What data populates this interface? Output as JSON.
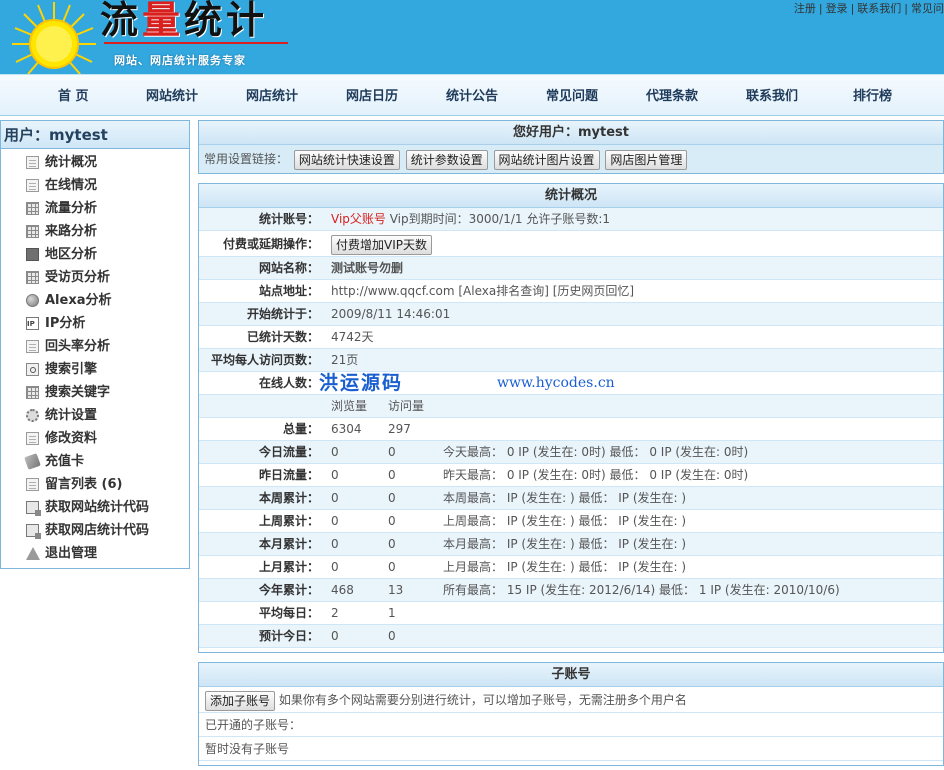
{
  "header": {
    "logo_title_1": "流",
    "logo_title_2": "量",
    "logo_title_3": "统计",
    "logo_subtitle": "网站、网店统计服务专家",
    "top_links": [
      "注册",
      "登录",
      "联系我们",
      "常见问"
    ]
  },
  "nav": {
    "items": [
      "首 页",
      "网站统计",
      "网店统计",
      "网店日历",
      "统计公告",
      "常见问题",
      "代理条款",
      "联系我们",
      "排行榜"
    ]
  },
  "sidebar": {
    "title": "用户：mytest",
    "items": [
      {
        "label": "统计概况",
        "icon": "document-icon"
      },
      {
        "label": "在线情况",
        "icon": "document-icon"
      },
      {
        "label": "流量分析",
        "icon": "grid-icon"
      },
      {
        "label": "来路分析",
        "icon": "grid-icon"
      },
      {
        "label": "地区分析",
        "icon": "map-icon"
      },
      {
        "label": "受访页分析",
        "icon": "grid-icon"
      },
      {
        "label": "Alexa分析",
        "icon": "globe-icon"
      },
      {
        "label": "IP分析",
        "icon": "ip-icon"
      },
      {
        "label": "回头率分析",
        "icon": "document-icon"
      },
      {
        "label": "搜索引擎",
        "icon": "search-icon"
      },
      {
        "label": "搜索关键字",
        "icon": "grid-icon"
      },
      {
        "label": "统计设置",
        "icon": "gear-icon"
      },
      {
        "label": "修改资料",
        "icon": "edit-icon"
      },
      {
        "label": "充值卡",
        "icon": "card-icon"
      },
      {
        "label": "留言列表 (6)",
        "icon": "message-icon"
      },
      {
        "label": "获取网站统计代码",
        "icon": "code-icon"
      },
      {
        "label": "获取网店统计代码",
        "icon": "code-icon"
      },
      {
        "label": "退出管理",
        "icon": "warning-icon"
      }
    ]
  },
  "user_panel": {
    "title": "您好用户：mytest",
    "quick_label": "常用设置链接：",
    "buttons": [
      "网站统计快速设置",
      "统计参数设置",
      "网站统计图片设置",
      "网店图片管理"
    ]
  },
  "stats": {
    "title": "统计概况",
    "account_label": "统计账号：",
    "account_vip": "Vip父账号",
    "account_info": "Vip到期时间：3000/1/1 允许子账号数:1",
    "pay_label": "付费或延期操作：",
    "pay_button": "付费增加VIP天数",
    "site_name_label": "网站名称：",
    "site_name": "测试账号勿删",
    "site_url_label": "站点地址：",
    "site_url": "http://www.qqcf.com [Alexa排名查询] [历史网页回忆]",
    "start_label": "开始统计于：",
    "start_value": "2009/8/11 14:46:01",
    "days_label": "已统计天数：",
    "days_value": "4742天",
    "avg_pages_label": "平均每人访问页数：",
    "avg_pages_value": "21页",
    "online_label": "在线人数：",
    "watermark_cn": "洪运源码",
    "watermark_url": "www.hycodes.cn",
    "col_pv": "浏览量",
    "col_visits": "访问量",
    "rows": [
      {
        "label": "总量：",
        "pv": "6304",
        "visits": "297",
        "note": ""
      },
      {
        "label": "今日流量：",
        "pv": "0",
        "visits": "0",
        "note": "今天最高： 0 IP (发生在: 0时) 最低： 0 IP (发生在: 0时)"
      },
      {
        "label": "昨日流量：",
        "pv": "0",
        "visits": "0",
        "note": "昨天最高： 0 IP (发生在: 0时) 最低： 0 IP (发生在: 0时)"
      },
      {
        "label": "本周累计：",
        "pv": "0",
        "visits": "0",
        "note": "本周最高： IP (发生在: ) 最低： IP (发生在: )"
      },
      {
        "label": "上周累计：",
        "pv": "0",
        "visits": "0",
        "note": "上周最高： IP (发生在: ) 最低： IP (发生在: )"
      },
      {
        "label": "本月累计：",
        "pv": "0",
        "visits": "0",
        "note": "本月最高： IP (发生在: ) 最低： IP (发生在: )"
      },
      {
        "label": "上月累计：",
        "pv": "0",
        "visits": "0",
        "note": "上月最高： IP (发生在: ) 最低： IP (发生在: )"
      },
      {
        "label": "今年累计：",
        "pv": "468",
        "visits": "13",
        "note": "所有最高： 15 IP (发生在: 2012/6/14) 最低： 1 IP (发生在: 2010/10/6)"
      },
      {
        "label": "平均每日：",
        "pv": "2",
        "visits": "1",
        "note": ""
      },
      {
        "label": "预计今日：",
        "pv": "0",
        "visits": "0",
        "note": ""
      }
    ]
  },
  "subaccount": {
    "title": "子账号",
    "add_button": "添加子账号",
    "add_hint": "如果你有多个网站需要分别进行统计，可以增加子账号，无需注册多个用户名",
    "opened_label": "已开通的子账号：",
    "empty_text": "暂时没有子账号"
  },
  "colors": {
    "header_bg": "#32a8df",
    "accent_red": "#d9201e",
    "border_blue": "#7fb6dc",
    "watermark_blue": "#1a5fd0"
  }
}
